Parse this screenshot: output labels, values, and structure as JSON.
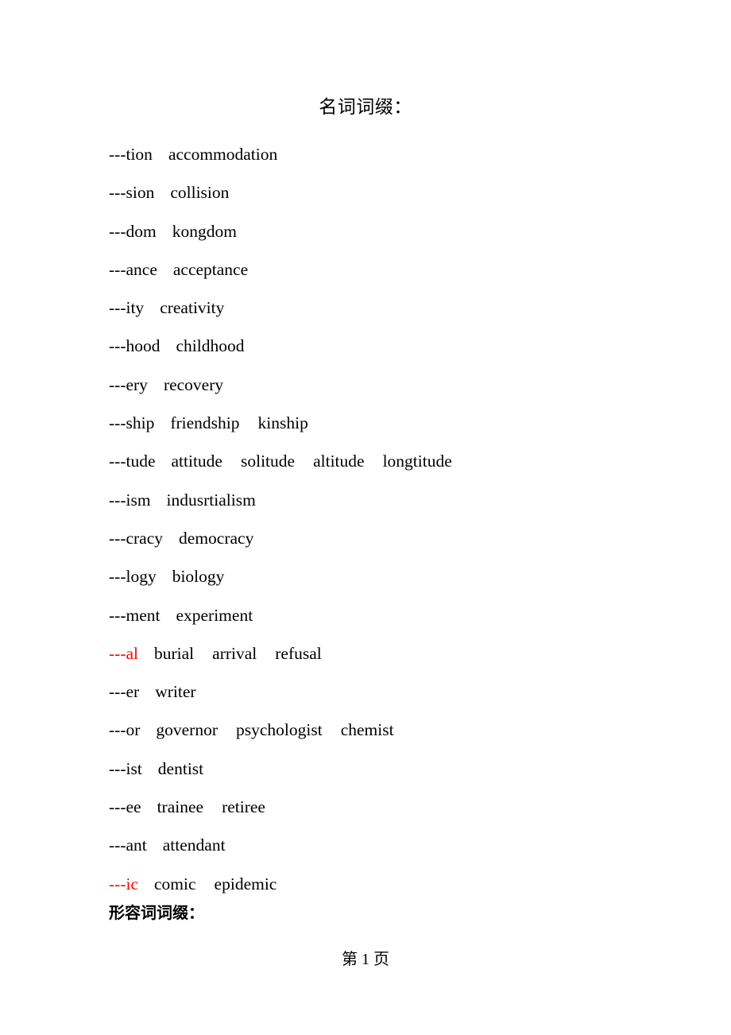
{
  "document": {
    "title": "名词词缀：",
    "sub_heading": "形容词词缀：",
    "footer": "第 1 页",
    "colors": {
      "text": "#000000",
      "highlight": "#ff0000",
      "background": "#ffffff"
    }
  },
  "suffixes": [
    {
      "key": "---tion",
      "key_color": "black",
      "words": [
        "accommodation"
      ]
    },
    {
      "key": "---sion",
      "key_color": "black",
      "words": [
        "collision"
      ]
    },
    {
      "key": "---dom",
      "key_color": "black",
      "words": [
        "kongdom"
      ]
    },
    {
      "key": "---ance",
      "key_color": "black",
      "words": [
        "acceptance"
      ]
    },
    {
      "key": "---ity",
      "key_color": "black",
      "words": [
        "creativity"
      ]
    },
    {
      "key": "---hood",
      "key_color": "black",
      "words": [
        "childhood"
      ]
    },
    {
      "key": "---ery",
      "key_color": "black",
      "words": [
        "recovery"
      ]
    },
    {
      "key": "---ship",
      "key_color": "black",
      "words": [
        "friendship",
        "kinship"
      ]
    },
    {
      "key": "---tude",
      "key_color": "black",
      "words": [
        "attitude",
        "solitude",
        "altitude",
        "longtitude"
      ]
    },
    {
      "key": "---ism",
      "key_color": "black",
      "words": [
        "indusrtialism"
      ]
    },
    {
      "key": "---cracy",
      "key_color": "black",
      "words": [
        "democracy"
      ]
    },
    {
      "key": "---logy",
      "key_color": "black",
      "words": [
        "biology"
      ]
    },
    {
      "key": "---ment",
      "key_color": "black",
      "words": [
        "experiment"
      ]
    },
    {
      "key": "---al",
      "key_color": "red",
      "words": [
        "burial",
        "arrival",
        "refusal"
      ]
    },
    {
      "key": "---er",
      "key_color": "black",
      "words": [
        "writer"
      ]
    },
    {
      "key": "---or",
      "key_color": "black",
      "words": [
        "governor",
        "psychologist",
        "chemist"
      ]
    },
    {
      "key": "---ist",
      "key_color": "black",
      "words": [
        "dentist"
      ]
    },
    {
      "key": "---ee",
      "key_color": "black",
      "words": [
        "trainee",
        "retiree"
      ]
    },
    {
      "key": "---ant",
      "key_color": "black",
      "words": [
        "attendant"
      ]
    },
    {
      "key": "---ic",
      "key_color": "red",
      "words": [
        "comic",
        "epidemic"
      ]
    }
  ]
}
